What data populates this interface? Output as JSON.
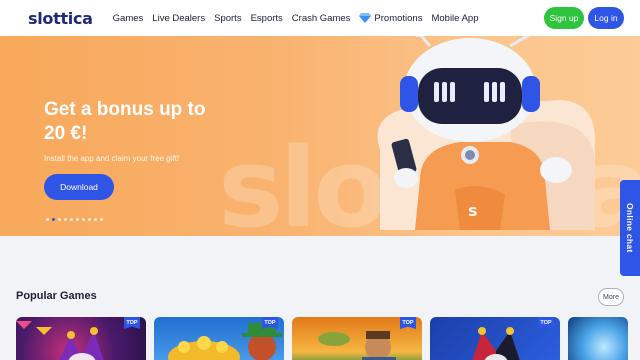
{
  "header": {
    "logo": "slottica",
    "nav": [
      "Games",
      "Live Dealers",
      "Sports",
      "Esports",
      "Crash Games",
      "Promotions",
      "Mobile App"
    ],
    "signup_label": "Sign up",
    "login_label": "Log in"
  },
  "hero": {
    "title": "Get a bonus up to 20 €!",
    "subtitle": "Install the app and claim your free gift!",
    "download_label": "Download",
    "watermark": "slottica",
    "slides_count": 10,
    "active_slide": 1
  },
  "chat": {
    "label": "Online chat"
  },
  "popular": {
    "title": "Popular Games",
    "more_label": "More",
    "badge": "TOP",
    "games": [
      {
        "name": "jester-slot-game",
        "top": true
      },
      {
        "name": "coins-leprechaun-game",
        "top": true
      },
      {
        "name": "fisherman-game",
        "top": true
      },
      {
        "name": "jester-joker-game",
        "top": true
      },
      {
        "name": "ice-game",
        "top": false
      }
    ]
  },
  "colors": {
    "accent": "#2f55e6",
    "signup": "#2ec43d",
    "hero_bg": "#f9b370",
    "brand": "#1e2a78"
  }
}
